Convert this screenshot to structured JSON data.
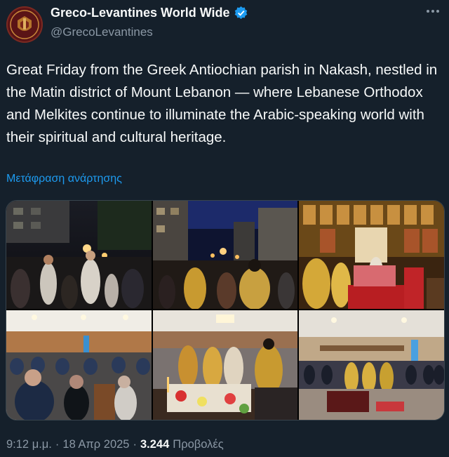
{
  "account": {
    "display_name": "Greco-Levantines World Wide",
    "handle": "@GrecoLevantines",
    "verified": true,
    "avatar_icon": "crest-icon"
  },
  "tweet": {
    "text": "Great Friday from the Greek Antiochian parish in Nakash, nestled in the Matin district of Mount Lebanon — where Lebanese Orthodox and Melkites continue to illuminate the Arabic-speaking world with their spiritual and cultural heritage.",
    "translate_label": "Μετάφραση ανάρτησης"
  },
  "media": {
    "count": 6,
    "photos": [
      "night-procession-crowd-photo",
      "procession-street-clergy-photo",
      "iconostasis-altar-photo",
      "church-congregation-photo",
      "epitaphios-clergy-photo",
      "church-nave-wide-photo"
    ]
  },
  "meta": {
    "time": "9:12 μ.μ.",
    "separator1": "·",
    "date": "18 Απρ 2025",
    "separator2": "·",
    "views_count": "3.244",
    "views_label": "Προβολές"
  },
  "colors": {
    "background": "#15202b",
    "text": "#f7f9f9",
    "secondary": "#8b98a5",
    "link": "#1d9bf0",
    "verified": "#1d9bf0"
  }
}
